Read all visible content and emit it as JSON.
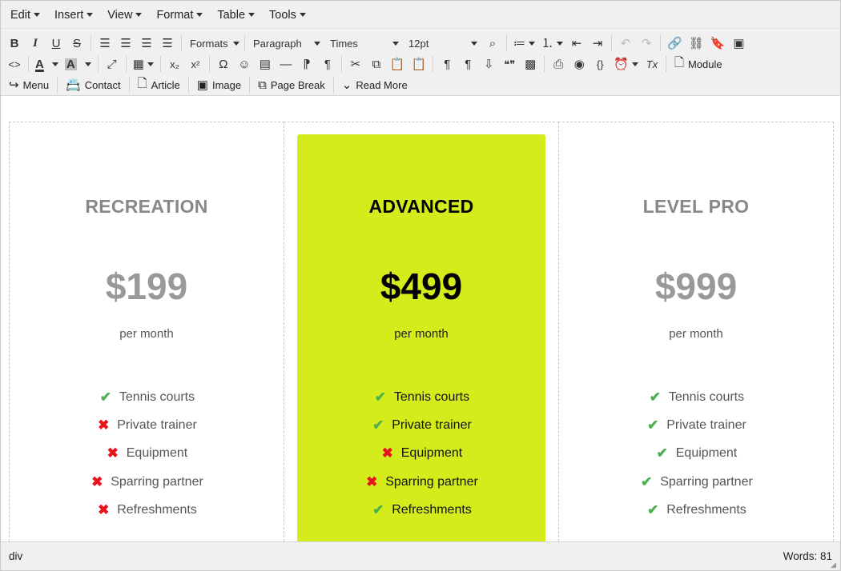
{
  "menubar": [
    "Edit",
    "Insert",
    "View",
    "Format",
    "Table",
    "Tools"
  ],
  "toolbar": {
    "formats": "Formats",
    "paragraph": "Paragraph",
    "font": "Times",
    "size": "12pt",
    "insert_buttons": {
      "menu": "Menu",
      "contact": "Contact",
      "article": "Article",
      "image": "Image",
      "page_break": "Page Break",
      "read_more": "Read More",
      "module": "Module"
    },
    "glyphs": {
      "bold": "B",
      "italic": "I",
      "underline": "U",
      "strike": "S",
      "code": "<>",
      "font_color": "A",
      "bg_color": "A",
      "sub": "x₂",
      "sup": "x²",
      "omega": "Ω",
      "smiley": "☺",
      "pilcrow": "¶",
      "quote": "❝❞",
      "code_braces": "{}",
      "clear": "Tx"
    }
  },
  "cards": [
    {
      "title": "RECREATION",
      "price": "$199",
      "period": "per month",
      "features": [
        {
          "label": "Tennis courts",
          "included": true
        },
        {
          "label": "Private trainer",
          "included": false
        },
        {
          "label": "Equipment",
          "included": false
        },
        {
          "label": "Sparring partner",
          "included": false
        },
        {
          "label": "Refreshments",
          "included": false
        }
      ]
    },
    {
      "title": "ADVANCED",
      "price": "$499",
      "period": "per month",
      "features": [
        {
          "label": "Tennis courts",
          "included": true
        },
        {
          "label": "Private trainer",
          "included": true
        },
        {
          "label": "Equipment",
          "included": false
        },
        {
          "label": "Sparring partner",
          "included": false
        },
        {
          "label": "Refreshments",
          "included": true
        }
      ]
    },
    {
      "title": "LEVEL PRO",
      "price": "$999",
      "period": "per month",
      "features": [
        {
          "label": "Tennis courts",
          "included": true
        },
        {
          "label": "Private trainer",
          "included": true
        },
        {
          "label": "Equipment",
          "included": true
        },
        {
          "label": "Sparring partner",
          "included": true
        },
        {
          "label": "Refreshments",
          "included": true
        }
      ]
    }
  ],
  "colors": {
    "highlight": "#d4ec1c",
    "check": "#4caf50",
    "cross": "#e8141b"
  },
  "statusbar": {
    "path": "div",
    "words": "Words: 81"
  }
}
